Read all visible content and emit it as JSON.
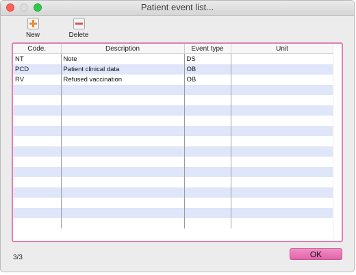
{
  "window": {
    "title": "Patient event list..."
  },
  "toolbar": {
    "new_label": "New",
    "delete_label": "Delete",
    "accent_new": "#e88a3a",
    "accent_delete": "#e0505e"
  },
  "table": {
    "columns": [
      "Code.",
      "Description",
      "Event type",
      "Unit"
    ],
    "rows": [
      [
        "NT",
        "Note",
        "DS",
        ""
      ],
      [
        "PCD",
        "Patient clinical data",
        "OB",
        ""
      ],
      [
        "RV",
        "Refused vaccination",
        "OB",
        ""
      ]
    ],
    "empty_rows": 14,
    "border_color": "#e07fb0",
    "alt_row_color": "#dfe6fa"
  },
  "footer": {
    "count": "3/3",
    "ok_label": "OK"
  }
}
